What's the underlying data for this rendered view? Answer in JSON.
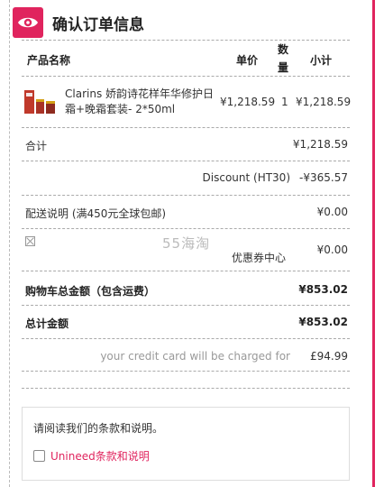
{
  "header": {
    "title": "确认订单信息",
    "icon": "eye-icon",
    "accent": "#e0245e"
  },
  "table": {
    "col_name": "产品名称",
    "col_price": "单价",
    "col_qty_1": "数",
    "col_qty_2": "量",
    "col_subtotal": "小计"
  },
  "product": {
    "name": "Clarins 娇韵诗花样年华修护日霜+晚霜套装- 2*50ml",
    "price": "¥1,218.59",
    "qty": "1",
    "subtotal": "¥1,218.59"
  },
  "summary": {
    "total_label": "合计",
    "total_value": "¥1,218.59",
    "discount_label": "Discount (HT30)",
    "discount_value": "-¥365.57",
    "shipping_label": "配送说明 (满450元全球包邮)",
    "shipping_value": "¥0.00",
    "coupon_label": "优惠券中心",
    "coupon_value": "¥0.00",
    "cart_total_label": "购物车总金额（包含运费）",
    "cart_total_value": "¥853.02",
    "grand_total_label": "总计金额",
    "grand_total_value": "¥853.02",
    "charged_label": "your credit card will be charged for",
    "charged_value": "£94.99"
  },
  "watermark": "55海淘",
  "terms": {
    "notice": "请阅读我们的条款和说明。",
    "link": "Unineed条款和说明"
  }
}
